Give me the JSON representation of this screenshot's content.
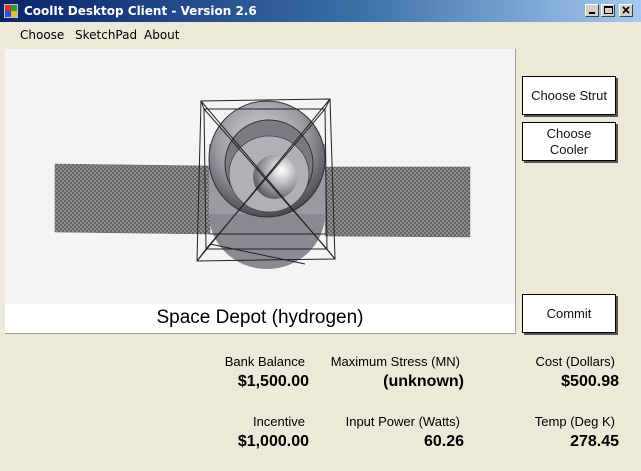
{
  "window": {
    "title": "CoolIt Desktop Client - Version 2.6"
  },
  "menu": {
    "items": [
      "Choose",
      "SketchPad",
      "About"
    ]
  },
  "viewport": {
    "caption": "Space Depot (hydrogen)"
  },
  "buttons": {
    "choose_strut": "Choose Strut",
    "choose_cooler_line1": "Choose",
    "choose_cooler_line2": "Cooler",
    "commit": "Commit"
  },
  "stats": {
    "bank_balance": {
      "label": "Bank Balance",
      "value": "$1,500.00"
    },
    "max_stress": {
      "label": "Maximum Stress (MN)",
      "value": "(unknown)"
    },
    "cost": {
      "label": "Cost (Dollars)",
      "value": "$500.98"
    },
    "incentive": {
      "label": "Incentive",
      "value": "$1,000.00"
    },
    "input_power": {
      "label": "Input Power (Watts)",
      "value": "60.26"
    },
    "temp": {
      "label": "Temp (Deg K)",
      "value": "278.45"
    }
  },
  "colors": {
    "title_start": "#0a246a",
    "title_end": "#a6caf0",
    "window_bg": "#ece9d8"
  }
}
